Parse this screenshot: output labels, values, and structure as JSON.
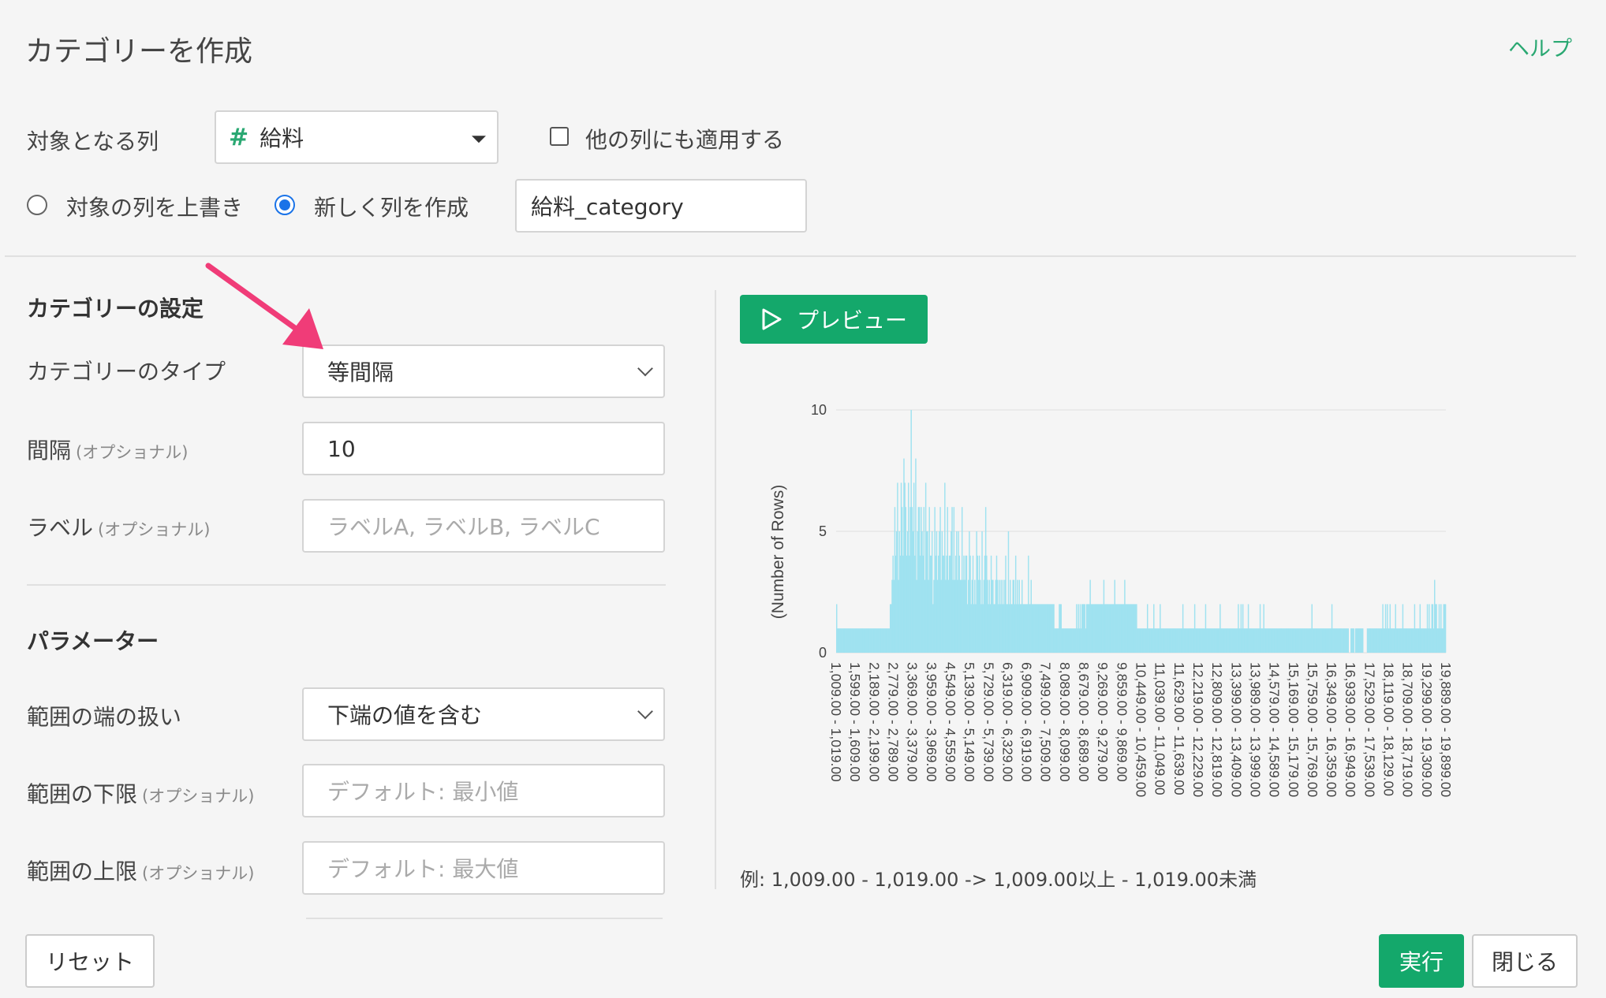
{
  "header": {
    "title": "カテゴリーを作成",
    "help": "ヘルプ"
  },
  "target": {
    "label": "対象となる列",
    "column_value": "給料",
    "apply_other_label": "他の列にも適用する",
    "apply_other_checked": false,
    "overwrite_label": "対象の列を上書き",
    "new_col_label": "新しく列を作成",
    "selected_mode": "new",
    "new_col_name": "給料_category"
  },
  "settings": {
    "section_title": "カテゴリーの設定",
    "type_label": "カテゴリーのタイプ",
    "type_value": "等間隔",
    "interval_label": "間隔",
    "optional": "(オプショナル)",
    "interval_value": "10",
    "label_label": "ラベル",
    "label_placeholder": "ラベルA, ラベルB, ラベルC"
  },
  "params": {
    "section_title": "パラメーター",
    "edge_label": "範囲の端の扱い",
    "edge_value": "下端の値を含む",
    "lower_label": "範囲の下限",
    "lower_placeholder": "デフォルト: 最小値",
    "upper_label": "範囲の上限",
    "upper_placeholder": "デフォルト: 最大値"
  },
  "preview": {
    "button": "プレビュー",
    "note": "例: 1,009.00 - 1,019.00 -> 1,009.00以上 - 1,019.00未満"
  },
  "footer": {
    "reset": "リセット",
    "run": "実行",
    "close": "閉じる"
  },
  "colors": {
    "accent": "#14a86b",
    "bar": "#9fe2f0",
    "radio": "#1a73e8",
    "arrow": "#f03c78"
  },
  "chart_data": {
    "type": "bar",
    "ylabel": "(Number of Rows)",
    "xlabel": "",
    "ylim": [
      0,
      10
    ],
    "yticks": [
      0,
      5,
      10
    ],
    "tick_labels": [
      "1,009.00 - 1,019.00",
      "1,599.00 - 1,609.00",
      "2,189.00 - 2,199.00",
      "2,779.00 - 2,789.00",
      "3,369.00 - 3,379.00",
      "3,959.00 - 3,969.00",
      "4,549.00 - 4,559.00",
      "5,139.00 - 5,149.00",
      "5,729.00 - 5,739.00",
      "6,319.00 - 6,329.00",
      "6,909.00 - 6,919.00",
      "7,499.00 - 7,509.00",
      "8,089.00 - 8,099.00",
      "8,679.00 - 8,689.00",
      "9,269.00 - 9,279.00",
      "9,859.00 - 9,869.00",
      "10,449.00 - 10,459.00",
      "11,039.00 - 11,049.00",
      "11,629.00 - 11,639.00",
      "12,219.00 - 12,229.00",
      "12,809.00 - 12,819.00",
      "13,399.00 - 13,409.00",
      "13,989.00 - 13,999.00",
      "14,579.00 - 14,589.00",
      "15,169.00 - 15,179.00",
      "15,759.00 - 15,769.00",
      "16,349.00 - 16,359.00",
      "16,939.00 - 16,949.00",
      "17,529.00 - 17,539.00",
      "18,119.00 - 18,129.00",
      "18,709.00 - 18,719.00",
      "19,299.00 - 19,309.00",
      "19,889.00 - 19,899.00"
    ],
    "values": [
      2,
      1,
      1,
      1,
      1,
      1,
      1,
      1,
      1,
      1,
      1,
      1,
      1,
      1,
      1,
      1,
      1,
      1,
      1,
      1,
      1,
      1,
      1,
      1,
      1,
      1,
      1,
      1,
      1,
      1,
      1,
      1,
      1,
      1,
      1,
      1,
      1,
      1,
      1,
      1,
      1,
      1,
      1,
      1,
      1,
      1,
      1,
      1,
      1,
      1,
      1,
      1,
      1,
      1,
      1,
      1,
      1,
      1,
      1,
      2,
      2,
      3,
      4,
      3,
      6,
      4,
      5,
      7,
      3,
      5,
      4,
      7,
      6,
      4,
      8,
      7,
      6,
      4,
      5,
      7,
      4,
      6,
      10,
      6,
      5,
      7,
      4,
      8,
      3,
      5,
      6,
      6,
      4,
      6,
      5,
      4,
      6,
      3,
      7,
      5,
      5,
      3,
      6,
      4,
      4,
      5,
      2,
      3,
      6,
      4,
      5,
      3,
      4,
      5,
      6,
      3,
      5,
      4,
      4,
      7,
      3,
      4,
      6,
      3,
      4,
      4,
      5,
      6,
      3,
      6,
      3,
      4,
      5,
      3,
      5,
      4,
      3,
      3,
      6,
      3,
      4,
      3,
      4,
      4,
      2,
      3,
      5,
      4,
      2,
      3,
      4,
      2,
      3,
      2,
      5,
      4,
      3,
      4,
      3,
      2,
      5,
      2,
      3,
      4,
      6,
      4,
      3,
      2,
      3,
      2,
      4,
      3,
      3,
      2,
      2,
      3,
      4,
      3,
      2,
      3,
      2,
      3,
      2,
      3,
      2,
      3,
      4,
      2,
      2,
      5,
      2,
      3,
      2,
      2,
      3,
      3,
      2,
      4,
      2,
      3,
      2,
      3,
      2,
      2,
      3,
      2,
      2,
      2,
      2,
      2,
      2,
      4,
      2,
      2,
      3,
      2,
      2,
      2,
      2,
      2,
      2,
      2,
      2,
      2,
      2,
      2,
      2,
      2,
      2,
      2,
      2,
      2,
      2,
      2,
      2,
      2,
      2,
      2,
      2,
      2,
      1,
      1,
      1,
      1,
      1,
      2,
      2,
      2,
      1,
      1,
      1,
      1,
      1,
      1,
      1,
      1,
      1,
      1,
      1,
      1,
      1,
      1,
      1,
      1,
      2,
      1,
      2,
      1,
      2,
      1,
      2,
      2,
      2,
      2,
      1,
      2,
      2,
      2,
      2,
      3,
      2,
      2,
      2,
      2,
      2,
      2,
      2,
      2,
      2,
      2,
      2,
      2,
      2,
      2,
      3,
      2,
      2,
      2,
      2,
      2,
      2,
      2,
      2,
      2,
      2,
      2,
      3,
      2,
      2,
      2,
      2,
      2,
      2,
      2,
      2,
      2,
      2,
      3,
      2,
      2,
      2,
      2,
      2,
      2,
      2,
      2,
      2,
      2,
      2,
      2,
      2,
      1,
      1,
      1,
      1,
      1,
      1,
      1,
      1,
      1,
      1,
      1,
      2,
      1,
      1,
      1,
      1,
      1,
      1,
      2,
      1,
      1,
      1,
      1,
      1,
      1,
      2,
      1,
      1,
      1,
      1,
      1,
      1,
      1,
      1,
      1,
      1,
      1,
      1,
      1,
      1,
      1,
      1,
      1,
      1,
      1,
      1,
      1,
      1,
      1,
      1,
      2,
      1,
      1,
      1,
      1,
      1,
      1,
      1,
      1,
      1,
      1,
      1,
      1,
      2,
      1,
      1,
      1,
      1,
      1,
      1,
      1,
      1,
      1,
      1,
      1,
      2,
      1,
      1,
      1,
      1,
      1,
      1,
      1,
      1,
      1,
      1,
      1,
      1,
      1,
      1,
      1,
      2,
      1,
      1,
      1,
      1,
      1,
      1,
      1,
      1,
      1,
      1,
      1,
      1,
      1,
      1,
      1,
      1,
      1,
      1,
      1,
      2,
      1,
      1,
      2,
      1,
      2,
      1,
      1,
      1,
      1,
      1,
      2,
      1,
      1,
      1,
      1,
      1,
      1,
      1,
      1,
      1,
      1,
      1,
      1,
      2,
      1,
      1,
      1,
      2,
      1,
      1,
      1,
      1,
      1,
      1,
      1,
      1,
      1,
      1,
      1,
      1,
      1,
      1,
      1,
      1,
      1,
      1,
      1,
      1,
      1,
      1,
      1,
      1,
      1,
      1,
      1,
      1,
      1,
      1,
      1,
      1,
      1,
      1,
      1,
      1,
      1,
      1,
      1,
      1,
      1,
      1,
      1,
      1,
      1,
      1,
      1,
      1,
      1,
      1,
      1,
      1,
      2,
      1,
      1,
      1,
      1,
      1,
      1,
      1,
      1,
      1,
      1,
      1,
      1,
      1,
      1,
      1,
      1,
      1,
      1,
      1,
      1,
      1,
      2,
      1,
      1,
      1,
      1,
      1,
      1,
      1,
      1,
      1,
      1,
      1,
      1,
      1,
      1,
      1,
      1,
      1,
      1,
      0,
      0,
      1,
      1,
      1,
      1,
      0,
      1,
      1,
      1,
      1,
      1,
      1,
      1,
      1,
      1,
      0,
      0,
      0,
      0,
      1,
      1,
      1,
      1,
      1,
      1,
      1,
      1,
      1,
      1,
      1,
      1,
      1,
      1,
      1,
      1,
      1,
      2,
      1,
      1,
      2,
      1,
      2,
      1,
      1,
      2,
      1,
      1,
      1,
      1,
      1,
      2,
      1,
      1,
      1,
      1,
      1,
      1,
      1,
      2,
      1,
      1,
      1,
      1,
      1,
      1,
      1,
      1,
      1,
      1,
      1,
      1,
      2,
      1,
      1,
      1,
      1,
      1,
      2,
      1,
      1,
      1,
      1,
      1,
      1,
      1,
      2,
      1,
      2,
      1,
      1,
      2,
      2,
      1,
      3,
      2,
      2,
      1,
      1,
      2,
      1,
      2,
      1,
      1,
      2,
      2,
      2
    ]
  }
}
